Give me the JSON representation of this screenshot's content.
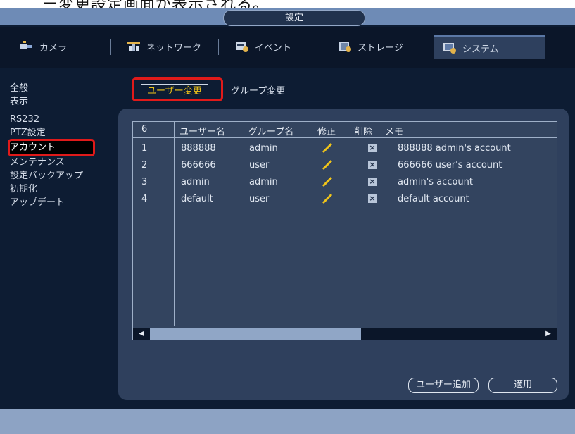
{
  "doc": {
    "caption_fragment": "ー変更設定画面が表示される。"
  },
  "window": {
    "title": "設定"
  },
  "tabs": [
    {
      "label": "カメラ",
      "icon": "camera-icon"
    },
    {
      "label": "ネットワーク",
      "icon": "network-icon"
    },
    {
      "label": "イベント",
      "icon": "event-icon"
    },
    {
      "label": "ストレージ",
      "icon": "storage-icon"
    },
    {
      "label": "システム",
      "icon": "system-icon"
    }
  ],
  "sidebar": {
    "items": [
      {
        "label": "全般"
      },
      {
        "label": "表示"
      },
      {
        "label": "RS232"
      },
      {
        "label": "PTZ設定"
      },
      {
        "label": "アカウント"
      },
      {
        "label": "メンテナンス"
      },
      {
        "label": "設定バックアップ"
      },
      {
        "label": "初期化"
      },
      {
        "label": "アップデート"
      }
    ]
  },
  "subtabs": {
    "user_change": "ユーザー変更",
    "group_change": "グループ変更"
  },
  "table": {
    "headers": [
      "6",
      "ユーザー名",
      "グループ名",
      "修正",
      "削除",
      "メモ"
    ],
    "rows": [
      {
        "no": "1",
        "user": "888888",
        "group": "admin",
        "memo": "888888 admin's account"
      },
      {
        "no": "2",
        "user": "666666",
        "group": "user",
        "memo": "666666 user's account"
      },
      {
        "no": "3",
        "user": "admin",
        "group": "admin",
        "memo": "admin's account"
      },
      {
        "no": "4",
        "user": "default",
        "group": "user",
        "memo": "default account"
      }
    ]
  },
  "buttons": {
    "add_user": "ユーザー追加",
    "apply": "適用"
  },
  "colors": {
    "accent_red": "#e01a1a",
    "active_text": "#f0c419"
  }
}
